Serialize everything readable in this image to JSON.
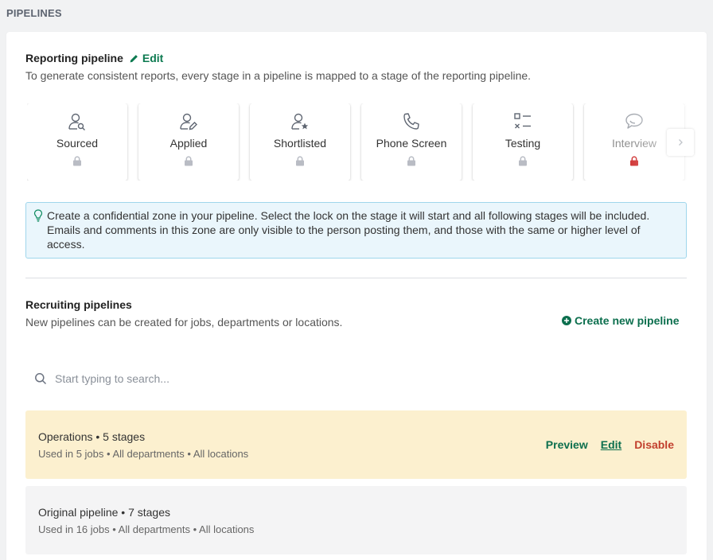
{
  "section_title": "PIPELINES",
  "reporting": {
    "title": "Reporting pipeline",
    "edit_label": "Edit",
    "description": "To generate consistent reports, every stage in a pipeline is mapped to a stage of the reporting pipeline.",
    "stages": [
      {
        "label": "Sourced",
        "icon": "user-search-icon",
        "locked": false
      },
      {
        "label": "Applied",
        "icon": "user-edit-icon",
        "locked": false
      },
      {
        "label": "Shortlisted",
        "icon": "user-star-icon",
        "locked": false
      },
      {
        "label": "Phone Screen",
        "icon": "phone-icon",
        "locked": false
      },
      {
        "label": "Testing",
        "icon": "checklist-icon",
        "locked": false
      },
      {
        "label": "Interview",
        "icon": "chat-bubbles-icon",
        "locked": true
      }
    ]
  },
  "info_text": "Create a confidential zone in your pipeline. Select the lock on the stage it will start and all following stages will be included. Emails and comments in this zone are only visible to the person posting them, and those with the same or higher level of access.",
  "recruiting": {
    "title": "Recruiting pipelines",
    "description": "New pipelines can be created for jobs, departments or locations.",
    "create_label": "Create new pipeline",
    "search_placeholder": "Start typing to search...",
    "pipelines": [
      {
        "name": "Operations • 5 stages",
        "meta": "Used in 5 jobs • All departments • All locations",
        "highlighted": true,
        "actions": {
          "preview": "Preview",
          "edit": "Edit",
          "disable": "Disable"
        }
      },
      {
        "name": "Original pipeline • 7 stages",
        "meta": "Used in 16 jobs • All departments • All locations",
        "highlighted": false
      }
    ]
  },
  "colors": {
    "accent_green": "#0c7a50",
    "danger_red": "#c2402e",
    "lock_active": "#d23b3b",
    "lock_inactive": "#b9bcc4",
    "info_bg": "#eaf6fc",
    "highlight_bg": "#fcf0cf"
  }
}
